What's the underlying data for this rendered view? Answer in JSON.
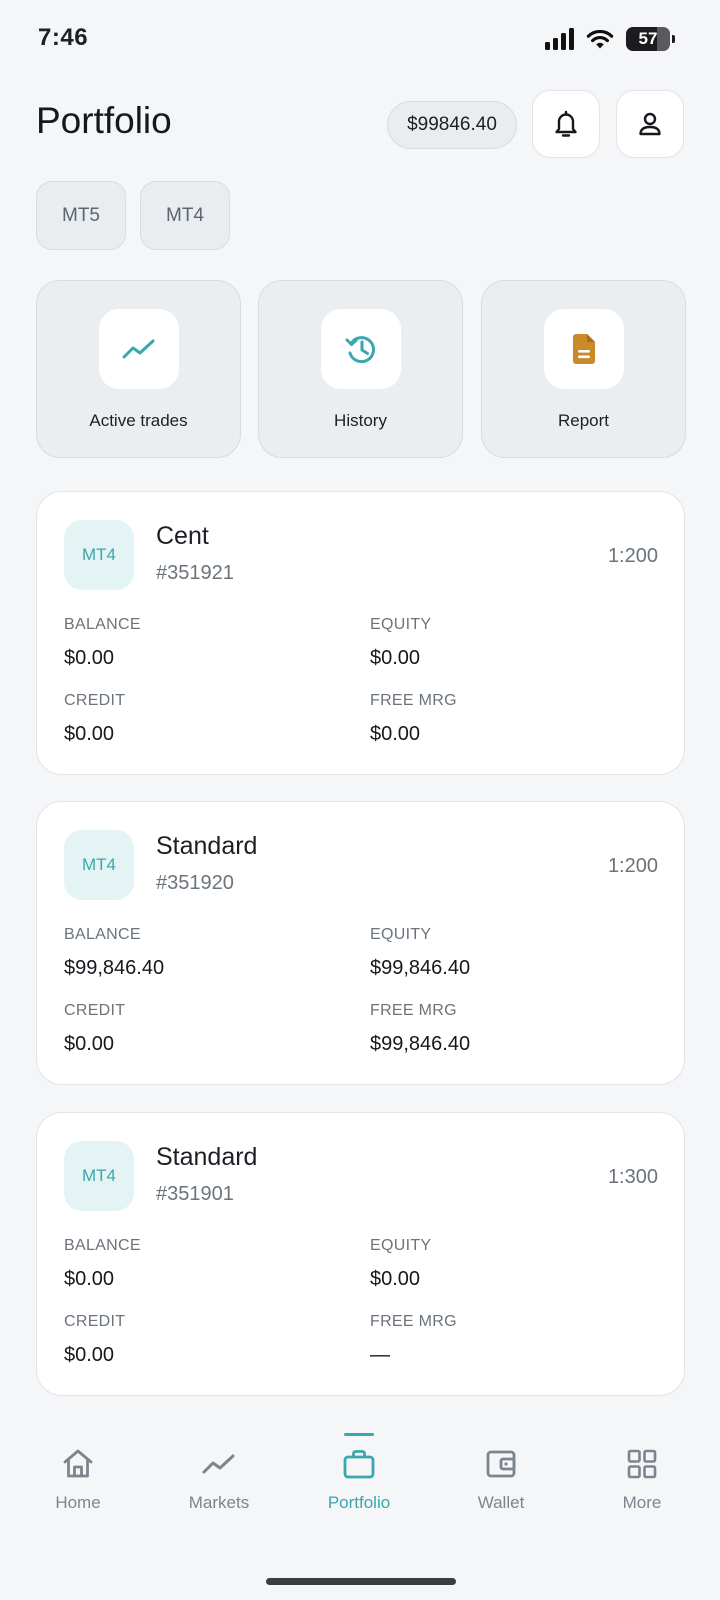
{
  "status_bar": {
    "time": "7:46",
    "battery": "57"
  },
  "header": {
    "title": "Portfolio",
    "balance": "$99846.40"
  },
  "platform_tabs": [
    {
      "label": "MT5"
    },
    {
      "label": "MT4"
    }
  ],
  "actions": [
    {
      "label": "Active trades"
    },
    {
      "label": "History"
    },
    {
      "label": "Report"
    }
  ],
  "accounts": [
    {
      "platform": "MT4",
      "type": "Cent",
      "number": "#351921",
      "leverage": "1:200",
      "balance_label": "BALANCE",
      "balance": "$0.00",
      "equity_label": "EQUITY",
      "equity": "$0.00",
      "credit_label": "CREDIT",
      "credit": "$0.00",
      "free_margin_label": "FREE MRG",
      "free_margin": "$0.00"
    },
    {
      "platform": "MT4",
      "type": "Standard",
      "number": "#351920",
      "leverage": "1:200",
      "balance_label": "BALANCE",
      "balance": "$99,846.40",
      "equity_label": "EQUITY",
      "equity": "$99,846.40",
      "credit_label": "CREDIT",
      "credit": "$0.00",
      "free_margin_label": "FREE MRG",
      "free_margin": "$99,846.40"
    },
    {
      "platform": "MT4",
      "type": "Standard",
      "number": "#351901",
      "leverage": "1:300",
      "balance_label": "BALANCE",
      "balance": "$0.00",
      "equity_label": "EQUITY",
      "equity": "$0.00",
      "credit_label": "CREDIT",
      "credit": "$0.00",
      "free_margin_label": "FREE MRG",
      "free_margin": "—"
    }
  ],
  "bottom_nav": [
    {
      "label": "Home",
      "icon": "home-icon"
    },
    {
      "label": "Markets",
      "icon": "chart-trend-icon"
    },
    {
      "label": "Portfolio",
      "icon": "briefcase-icon",
      "active": true
    },
    {
      "label": "Wallet",
      "icon": "wallet-icon"
    },
    {
      "label": "More",
      "icon": "grid-icon"
    }
  ],
  "colors": {
    "accent": "#3aa6ad",
    "report_icon": "#c98a2b",
    "background": "#f4f6f8"
  }
}
